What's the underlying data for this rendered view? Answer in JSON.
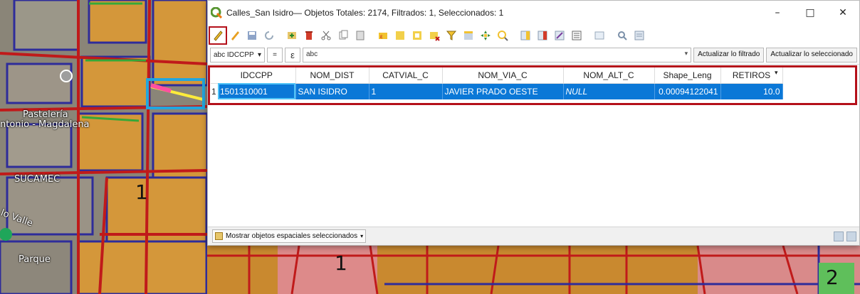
{
  "window": {
    "title": "Calles_San Isidro— Objetos Totales: 2174, Filtrados: 1, Seleccionados: 1",
    "minimize": "–",
    "maximize": "□",
    "close": "✕"
  },
  "toolbar": {
    "icons": [
      "pencil-edit-icon",
      "multi-edit-icon",
      "save-edits-icon",
      "reload-icon",
      "add-feature-icon",
      "delete-feature-icon",
      "cut-icon",
      "copy-icon",
      "paste-icon",
      "select-expression-icon",
      "select-all-icon",
      "invert-selection-icon",
      "deselect-icon",
      "filter-select-icon",
      "move-selected-top-icon",
      "pan-to-selected-icon",
      "zoom-to-selected-icon",
      "new-field-icon",
      "delete-field-icon",
      "field-calculator-icon",
      "conditional-format-icon",
      "dock-icon",
      "actions-icon",
      "form-view-icon"
    ]
  },
  "filter": {
    "field_prefix": "abc",
    "field": "IDCCPP",
    "operator": "=",
    "expression_symbol": "ε",
    "value_placeholder": "abc",
    "update_filtered_label": "Actualizar lo filtrado",
    "update_selected_label": "Actualizar lo seleccionado"
  },
  "table": {
    "columns": [
      "IDCCPP",
      "NOM_DIST",
      "CATVIAL_C",
      "NOM_VIA_C",
      "NOM_ALT_C",
      "Shape_Leng",
      "RETIROS"
    ],
    "rows": [
      {
        "index": "1",
        "IDCCPP": "1501310001",
        "NOM_DIST": "SAN ISIDRO",
        "CATVIAL_C": "1",
        "NOM_VIA_C": "JAVIER PRADO OESTE",
        "NOM_ALT_C": "NULL",
        "Shape_Leng": "0.00094122041",
        "RETIROS": "10.0"
      }
    ]
  },
  "bottom": {
    "mode_label": "Mostrar objetos espaciales seleccionados"
  },
  "map": {
    "labels": [
      "Pastelería",
      "ntonio - Magdalena",
      "SUCAMEC",
      "lo Valle",
      "Parque"
    ]
  },
  "colors": {
    "selection_blue": "#0b78d7",
    "highlight_red": "#b4101a",
    "highlight_cyan": "#22a6de"
  }
}
